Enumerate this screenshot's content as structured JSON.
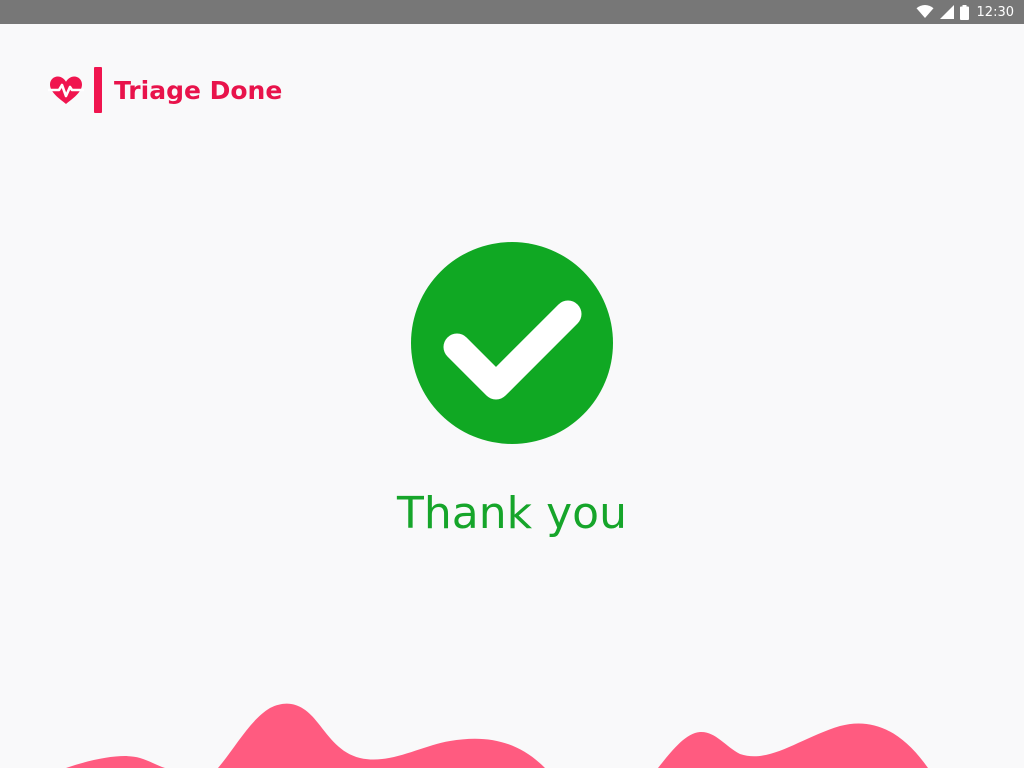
{
  "status_bar": {
    "time": "12:30",
    "icons": [
      "wifi-icon",
      "cell-signal-icon",
      "battery-icon"
    ]
  },
  "header": {
    "logo_icon": "heart-pulse-icon",
    "title": "Triage Done"
  },
  "main": {
    "status_icon": "check-circle-icon",
    "message": "Thank you"
  },
  "colors": {
    "brand": "#f0154f",
    "success": "#10a823",
    "status_bar": "#777777",
    "background": "#f9f9fa",
    "wave": "#ff5b80"
  }
}
